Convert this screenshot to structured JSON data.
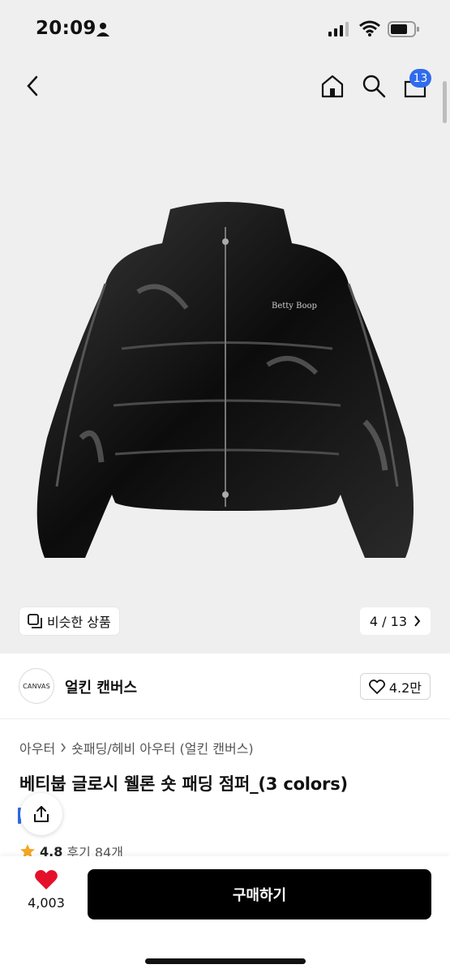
{
  "status": {
    "time": "20:09"
  },
  "nav": {
    "cart_count": "13"
  },
  "hero": {
    "similar_label": "비슷한 상품",
    "counter": "4 / 13",
    "jacket_logo_text": "Betty Boop"
  },
  "seller": {
    "logo_text": "CANVAS",
    "name": "얼킨 캔버스",
    "likes": "4.2만"
  },
  "product": {
    "breadcrumb": [
      "아우터",
      "숏패딩/헤비 아우터 (얼킨 캔버스)"
    ],
    "title": "베티붑 글로시 웰론 숏 패딩 점퍼_(3 colors)",
    "rating": "4.8",
    "reviews": "후기 84개"
  },
  "bottom": {
    "like_count": "4,003",
    "buy_label": "구매하기"
  }
}
